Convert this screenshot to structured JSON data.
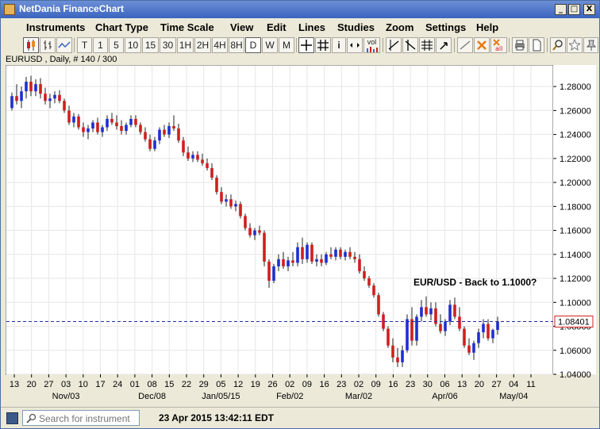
{
  "window": {
    "title": "NetDania FinanceChart",
    "min": "_",
    "max": "□",
    "close": "X"
  },
  "menu": [
    "Instruments",
    "Chart Type",
    "Time Scale",
    "View",
    "Edit",
    "Lines",
    "Studies",
    "Zoom",
    "Settings",
    "Help"
  ],
  "toolbar": {
    "timescales": [
      "T",
      "1",
      "5",
      "10",
      "15",
      "30",
      "1H",
      "2H",
      "4H",
      "8H",
      "D",
      "W",
      "M"
    ],
    "active_timescale": "D",
    "info_button": "i",
    "vol_button": "vol"
  },
  "info": {
    "label": "EURUSD , Daily, # 140 / 300"
  },
  "status": {
    "search_placeholder": "Search for instrument",
    "datetime": "23 Apr 2015 13:42:11 EDT"
  },
  "chart_data": {
    "type": "candlestick",
    "symbol": "EURUSD",
    "annotation": "EUR/USD - Back to 1.1000?",
    "current_price": 1.08401,
    "current_price_label": "1.08401",
    "ylim": [
      1.04,
      1.29
    ],
    "y_ticks": [
      "1.28000",
      "1.26000",
      "1.24000",
      "1.22000",
      "1.20000",
      "1.18000",
      "1.16000",
      "1.14000",
      "1.12000",
      "1.10000",
      "1.08000",
      "1.06000",
      "1.04000"
    ],
    "x_day_labels": [
      "13",
      "20",
      "27",
      "03",
      "10",
      "17",
      "24",
      "01",
      "08",
      "15",
      "22",
      "29",
      "05",
      "12",
      "19",
      "26",
      "02",
      "09",
      "16",
      "23",
      "02",
      "09",
      "16",
      "23",
      "30",
      "06",
      "13",
      "20",
      "27",
      "04",
      "11"
    ],
    "x_month_labels": [
      {
        "label": "Nov/03",
        "day_index": 3
      },
      {
        "label": "Dec/08",
        "day_index": 8
      },
      {
        "label": "Jan/05/15",
        "day_index": 12
      },
      {
        "label": "Feb/02",
        "day_index": 16
      },
      {
        "label": "Mar/02",
        "day_index": 20
      },
      {
        "label": "Apr/06",
        "day_index": 25
      },
      {
        "label": "May/04",
        "day_index": 29
      }
    ],
    "candles": [
      [
        1.262,
        1.275,
        1.26,
        1.272
      ],
      [
        1.272,
        1.282,
        1.265,
        1.268
      ],
      [
        1.268,
        1.28,
        1.262,
        1.276
      ],
      [
        1.276,
        1.288,
        1.27,
        1.284
      ],
      [
        1.284,
        1.289,
        1.272,
        1.276
      ],
      [
        1.276,
        1.286,
        1.272,
        1.282
      ],
      [
        1.282,
        1.287,
        1.27,
        1.274
      ],
      [
        1.274,
        1.279,
        1.265,
        1.268
      ],
      [
        1.268,
        1.274,
        1.262,
        1.27
      ],
      [
        1.27,
        1.276,
        1.266,
        1.273
      ],
      [
        1.273,
        1.277,
        1.266,
        1.268
      ],
      [
        1.268,
        1.27,
        1.258,
        1.26
      ],
      [
        1.26,
        1.264,
        1.248,
        1.25
      ],
      [
        1.25,
        1.258,
        1.246,
        1.255
      ],
      [
        1.255,
        1.257,
        1.244,
        1.246
      ],
      [
        1.246,
        1.25,
        1.238,
        1.242
      ],
      [
        1.242,
        1.248,
        1.236,
        1.245
      ],
      [
        1.245,
        1.252,
        1.242,
        1.25
      ],
      [
        1.25,
        1.254,
        1.24,
        1.242
      ],
      [
        1.242,
        1.248,
        1.238,
        1.246
      ],
      [
        1.246,
        1.256,
        1.243,
        1.253
      ],
      [
        1.253,
        1.258,
        1.248,
        1.25
      ],
      [
        1.25,
        1.256,
        1.244,
        1.247
      ],
      [
        1.247,
        1.252,
        1.24,
        1.243
      ],
      [
        1.243,
        1.25,
        1.24,
        1.248
      ],
      [
        1.248,
        1.256,
        1.246,
        1.253
      ],
      [
        1.253,
        1.256,
        1.246,
        1.248
      ],
      [
        1.248,
        1.25,
        1.24,
        1.242
      ],
      [
        1.242,
        1.246,
        1.234,
        1.236
      ],
      [
        1.236,
        1.24,
        1.226,
        1.228
      ],
      [
        1.228,
        1.238,
        1.226,
        1.235
      ],
      [
        1.235,
        1.246,
        1.232,
        1.244
      ],
      [
        1.244,
        1.248,
        1.238,
        1.24
      ],
      [
        1.24,
        1.25,
        1.237,
        1.247
      ],
      [
        1.247,
        1.256,
        1.243,
        1.245
      ],
      [
        1.245,
        1.249,
        1.233,
        1.235
      ],
      [
        1.235,
        1.238,
        1.222,
        1.225
      ],
      [
        1.225,
        1.23,
        1.218,
        1.22
      ],
      [
        1.22,
        1.226,
        1.217,
        1.223
      ],
      [
        1.223,
        1.226,
        1.217,
        1.219
      ],
      [
        1.219,
        1.224,
        1.214,
        1.216
      ],
      [
        1.216,
        1.22,
        1.21,
        1.212
      ],
      [
        1.212,
        1.216,
        1.202,
        1.204
      ],
      [
        1.204,
        1.206,
        1.19,
        1.192
      ],
      [
        1.192,
        1.196,
        1.182,
        1.184
      ],
      [
        1.184,
        1.19,
        1.18,
        1.186
      ],
      [
        1.186,
        1.19,
        1.178,
        1.18
      ],
      [
        1.18,
        1.185,
        1.176,
        1.182
      ],
      [
        1.182,
        1.184,
        1.17,
        1.172
      ],
      [
        1.172,
        1.174,
        1.16,
        1.162
      ],
      [
        1.162,
        1.166,
        1.154,
        1.156
      ],
      [
        1.156,
        1.162,
        1.152,
        1.16
      ],
      [
        1.16,
        1.164,
        1.156,
        1.158
      ],
      [
        1.158,
        1.16,
        1.13,
        1.134
      ],
      [
        1.134,
        1.136,
        1.112,
        1.118
      ],
      [
        1.118,
        1.132,
        1.116,
        1.13
      ],
      [
        1.13,
        1.14,
        1.126,
        1.136
      ],
      [
        1.136,
        1.142,
        1.128,
        1.13
      ],
      [
        1.13,
        1.138,
        1.126,
        1.135
      ],
      [
        1.135,
        1.142,
        1.13,
        1.133
      ],
      [
        1.133,
        1.15,
        1.13,
        1.146
      ],
      [
        1.146,
        1.154,
        1.132,
        1.136
      ],
      [
        1.136,
        1.15,
        1.133,
        1.148
      ],
      [
        1.148,
        1.15,
        1.132,
        1.134
      ],
      [
        1.134,
        1.14,
        1.13,
        1.136
      ],
      [
        1.136,
        1.14,
        1.13,
        1.133
      ],
      [
        1.133,
        1.142,
        1.131,
        1.14
      ],
      [
        1.14,
        1.146,
        1.136,
        1.138
      ],
      [
        1.138,
        1.146,
        1.135,
        1.144
      ],
      [
        1.144,
        1.146,
        1.136,
        1.138
      ],
      [
        1.138,
        1.144,
        1.135,
        1.142
      ],
      [
        1.142,
        1.146,
        1.136,
        1.138
      ],
      [
        1.138,
        1.142,
        1.133,
        1.136
      ],
      [
        1.136,
        1.14,
        1.124,
        1.126
      ],
      [
        1.126,
        1.13,
        1.118,
        1.12
      ],
      [
        1.12,
        1.122,
        1.112,
        1.114
      ],
      [
        1.114,
        1.116,
        1.104,
        1.106
      ],
      [
        1.106,
        1.108,
        1.088,
        1.09
      ],
      [
        1.09,
        1.092,
        1.076,
        1.078
      ],
      [
        1.078,
        1.08,
        1.062,
        1.064
      ],
      [
        1.064,
        1.07,
        1.05,
        1.054
      ],
      [
        1.054,
        1.062,
        1.046,
        1.05
      ],
      [
        1.05,
        1.064,
        1.046,
        1.06
      ],
      [
        1.06,
        1.09,
        1.058,
        1.086
      ],
      [
        1.086,
        1.096,
        1.064,
        1.068
      ],
      [
        1.068,
        1.09,
        1.064,
        1.088
      ],
      [
        1.088,
        1.102,
        1.084,
        1.096
      ],
      [
        1.096,
        1.105,
        1.088,
        1.09
      ],
      [
        1.09,
        1.1,
        1.085,
        1.095
      ],
      [
        1.095,
        1.1,
        1.08,
        1.082
      ],
      [
        1.082,
        1.09,
        1.074,
        1.076
      ],
      [
        1.076,
        1.086,
        1.072,
        1.084
      ],
      [
        1.084,
        1.102,
        1.081,
        1.098
      ],
      [
        1.098,
        1.104,
        1.086,
        1.088
      ],
      [
        1.088,
        1.096,
        1.076,
        1.078
      ],
      [
        1.078,
        1.08,
        1.062,
        1.064
      ],
      [
        1.064,
        1.07,
        1.056,
        1.058
      ],
      [
        1.058,
        1.068,
        1.052,
        1.066
      ],
      [
        1.066,
        1.078,
        1.062,
        1.075
      ],
      [
        1.075,
        1.086,
        1.07,
        1.082
      ],
      [
        1.082,
        1.086,
        1.068,
        1.07
      ],
      [
        1.07,
        1.078,
        1.066,
        1.077
      ],
      [
        1.077,
        1.088,
        1.073,
        1.084
      ]
    ],
    "colors": {
      "up": "#1f2fd0",
      "down": "#d01f1f",
      "price_line": "#1f2fa0",
      "grid": "#e6e6e6"
    }
  }
}
